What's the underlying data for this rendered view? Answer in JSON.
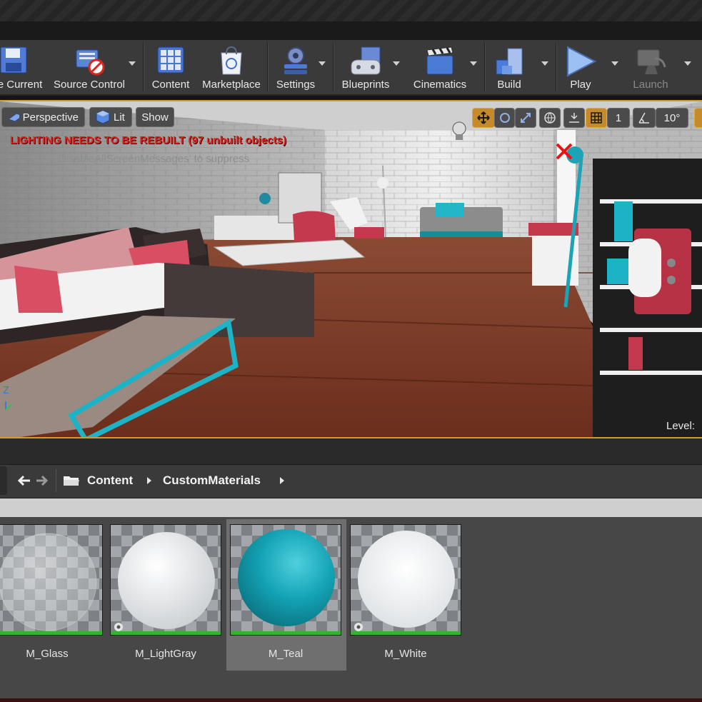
{
  "toolbar": {
    "buttons": [
      {
        "label": "e Current",
        "icon": "save-icon"
      },
      {
        "label": "Source Control",
        "icon": "source-control-icon"
      },
      {
        "label": "Content",
        "icon": "content-icon"
      },
      {
        "label": "Marketplace",
        "icon": "marketplace-icon"
      },
      {
        "label": "Settings",
        "icon": "settings-icon"
      },
      {
        "label": "Blueprints",
        "icon": "blueprints-icon"
      },
      {
        "label": "Cinematics",
        "icon": "cinematics-icon"
      },
      {
        "label": "Build",
        "icon": "build-icon"
      },
      {
        "label": "Play",
        "icon": "play-icon"
      },
      {
        "label": "Launch",
        "icon": "launch-icon",
        "disabled": true
      }
    ]
  },
  "viewport": {
    "perspective_label": "Perspective",
    "lit_label": "Lit",
    "show_label": "Show",
    "warning": "LIGHTING NEEDS TO BE REBUILT (97 unbuilt objects)",
    "suppress_hint": "DisableAllScreenMessages' to suppress",
    "snap_value": "1",
    "angle_value": "10°",
    "level_label": "Level:",
    "axis_label": "Z"
  },
  "content_browser": {
    "breadcrumb": [
      "Content",
      "CustomMaterials"
    ],
    "assets": [
      {
        "name": "M_Glass",
        "color": "#cfd3d5"
      },
      {
        "name": "M_LightGray",
        "color": "#e8ebee"
      },
      {
        "name": "M_Teal",
        "color": "#13a2b4",
        "selected": true
      },
      {
        "name": "M_White",
        "color": "#f2f4f5"
      }
    ]
  },
  "colors": {
    "accent": "#d49a2a",
    "warning": "#e8221b",
    "asset_bar": "#35b22e"
  }
}
